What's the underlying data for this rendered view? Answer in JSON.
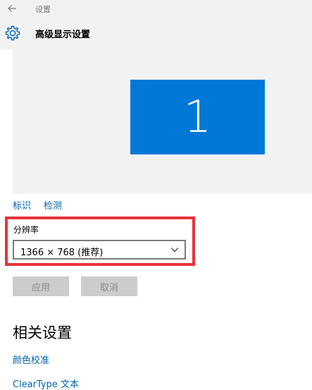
{
  "window": {
    "title": "设置"
  },
  "header": {
    "title": "高级显示设置",
    "icon": "gear-icon"
  },
  "display_preview": {
    "monitor_number": "1",
    "monitor_color": "#0078d7"
  },
  "display_links": {
    "identify": "标识",
    "detect": "检测"
  },
  "resolution": {
    "label": "分辨率",
    "selected_value": "1366 × 768 (推荐)"
  },
  "buttons": {
    "apply": "应用",
    "cancel": "取消"
  },
  "related_settings": {
    "heading": "相关设置",
    "links": [
      "颜色校准",
      "ClearType 文本"
    ]
  },
  "colors": {
    "accent": "#0078d7",
    "link": "#0063b1",
    "highlight_border": "#e8333a"
  }
}
